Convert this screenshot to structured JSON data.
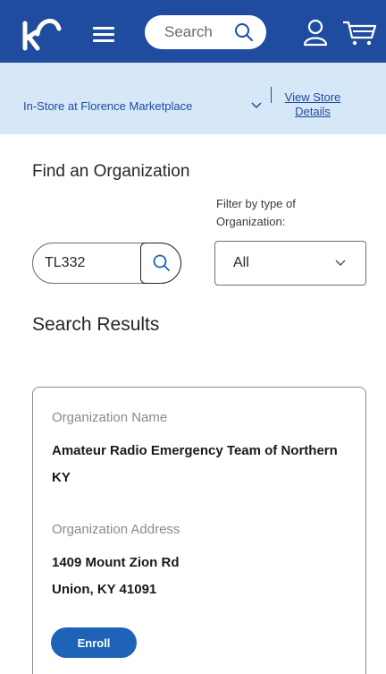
{
  "header": {
    "search_placeholder": "Search",
    "colors": {
      "brand": "#1f4c9e",
      "banner": "#d6e7f8"
    }
  },
  "store": {
    "label": "In-Store at Florence Marketplace",
    "details_link": "View Store Details"
  },
  "find": {
    "title": "Find an Organization",
    "filter_label": "Filter by type of Organization:",
    "search_value": "TL332",
    "filter_value": "All"
  },
  "results": {
    "title": "Search Results",
    "items": [
      {
        "name_label": "Organization Name",
        "name": "Amateur Radio Emergency Team of Northern KY",
        "address_label": "Organization Address",
        "address_line1": "1409 Mount Zion Rd",
        "address_line2": "Union, KY 41091",
        "button": "Enroll"
      }
    ]
  },
  "icons": [
    "kroger-logo-icon",
    "menu-icon",
    "search-icon",
    "user-icon",
    "cart-icon",
    "chevron-down-icon"
  ]
}
